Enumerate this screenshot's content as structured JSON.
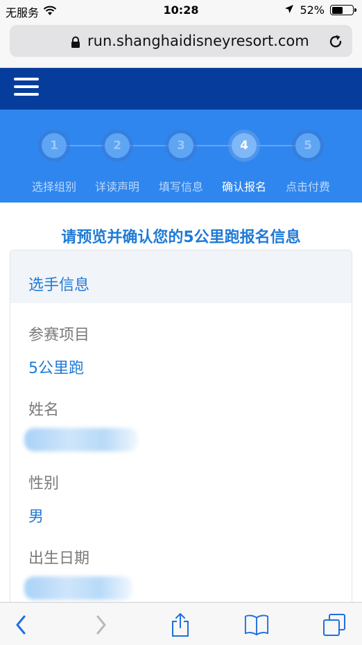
{
  "status_bar": {
    "carrier": "无服务",
    "time": "10:28",
    "battery_percent": "52%",
    "battery_level": 0.52
  },
  "browser": {
    "url": "run.shanghaidisneyresort.com"
  },
  "steps": [
    {
      "number": "1",
      "label": "选择组别",
      "active": false
    },
    {
      "number": "2",
      "label": "详读声明",
      "active": false
    },
    {
      "number": "3",
      "label": "填写信息",
      "active": false
    },
    {
      "number": "4",
      "label": "确认报名",
      "active": true
    },
    {
      "number": "5",
      "label": "点击付费",
      "active": false
    }
  ],
  "page": {
    "title": "请预览并确认您的5公里跑报名信息"
  },
  "card": {
    "title": "选手信息",
    "fields": [
      {
        "label": "参赛项目",
        "value": "5公里跑"
      },
      {
        "label": "姓名",
        "value": ""
      },
      {
        "label": "性别",
        "value": "男"
      },
      {
        "label": "出生日期",
        "value": ""
      }
    ]
  },
  "colors": {
    "nav_dark": "#063d9c",
    "steps_blue": "#2f86ee",
    "accent": "#1f7ad6"
  },
  "icons": {
    "back": "chevron-left-icon",
    "forward": "chevron-right-icon",
    "share": "share-icon",
    "bookmarks": "book-icon",
    "tabs": "tabs-icon"
  }
}
